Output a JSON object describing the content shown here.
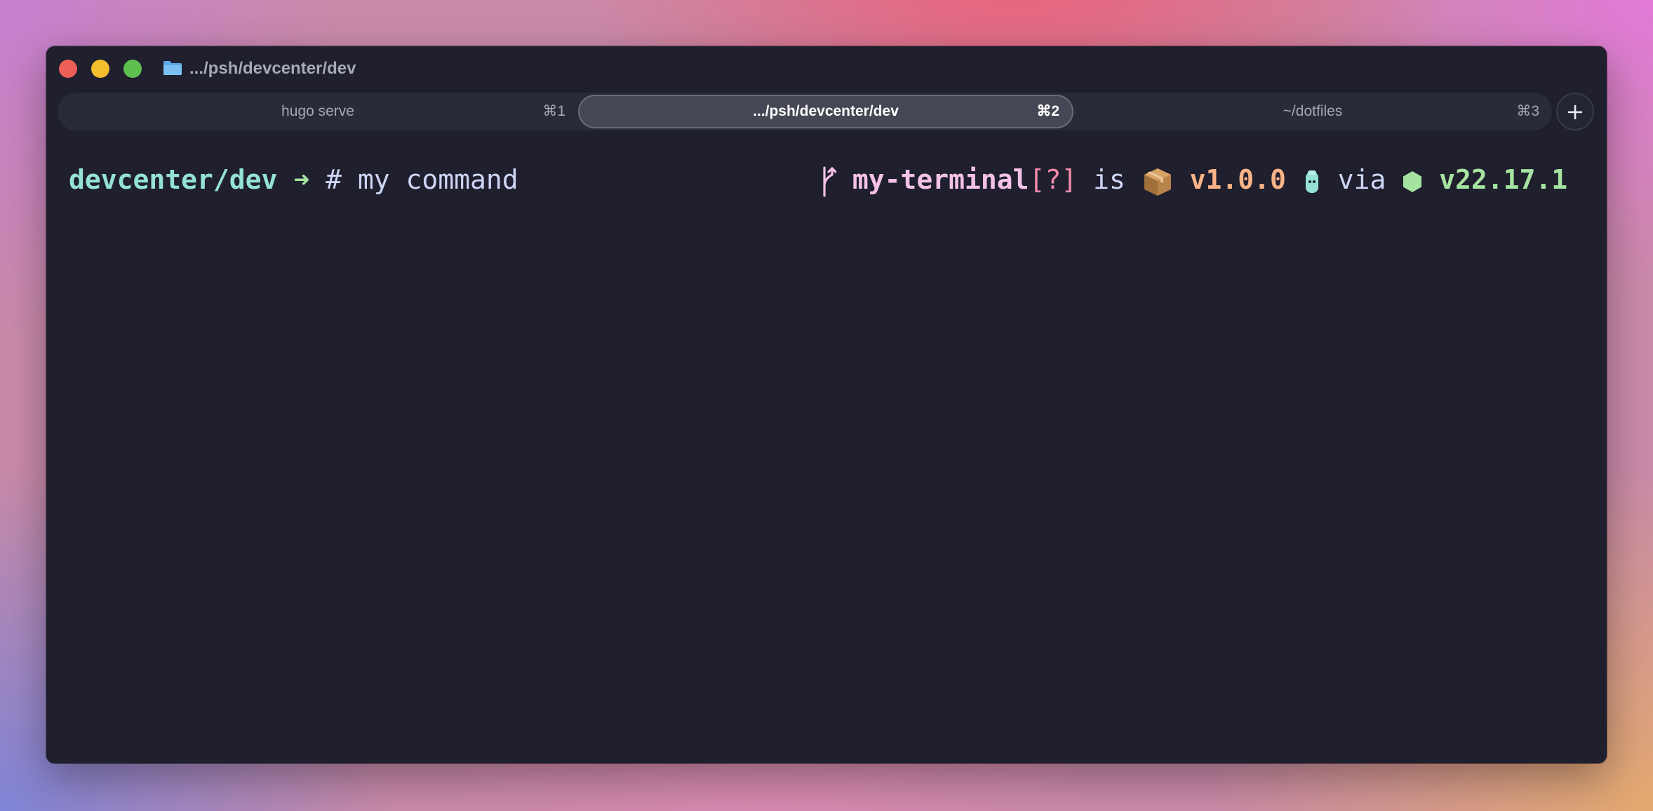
{
  "window": {
    "title": ".../psh/devcenter/dev"
  },
  "tabs": [
    {
      "label": "hugo serve",
      "shortcut": "⌘1",
      "active": false
    },
    {
      "label": ".../psh/devcenter/dev",
      "shortcut": "⌘2",
      "active": true
    },
    {
      "label": "~/dotfiles",
      "shortcut": "⌘3",
      "active": false
    }
  ],
  "new_tab_label": "+",
  "prompt": {
    "cwd": "devcenter/dev",
    "arrow": "➜",
    "command": "# my command",
    "branch_symbol": "",
    "repo": "my-terminal",
    "git_status": "[?]",
    "word_is": "is",
    "package_icon": "package-icon",
    "package_version": "v1.0.0",
    "bun_icon": "bun-icon",
    "word_via": "via",
    "node_icon": "node-hexagon-icon",
    "node_version": "v22.17.1"
  },
  "colors": {
    "cwd": "#94e2d5",
    "arrow": "#a6e3a1",
    "repo": "#f5c2e7",
    "git_status": "#f38ba8",
    "package_version": "#fab387",
    "node_version": "#a6e3a1",
    "background": "#1f1f2e"
  }
}
